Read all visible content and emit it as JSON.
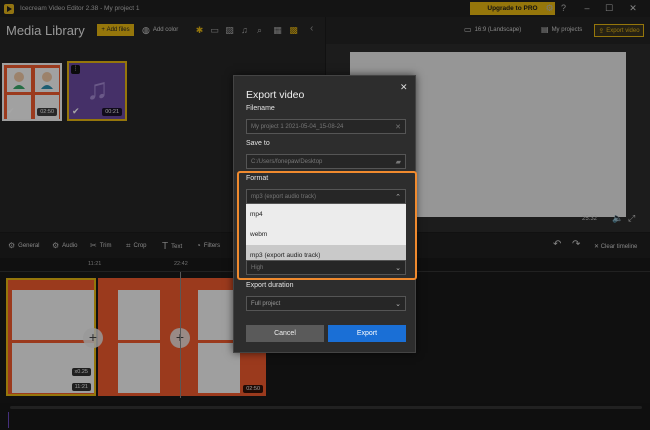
{
  "titlebar": {
    "title": "Icecream Video Editor 2.38 - My project 1",
    "upgrade_label": "Upgrade to PRO"
  },
  "media_library": {
    "title": "Media Library",
    "add_files": "Add files",
    "add_color": "Add color",
    "items": [
      {
        "duration": "02:50"
      },
      {
        "duration": "00:21"
      }
    ]
  },
  "preview": {
    "aspect_label": "16:9 (Landscape)",
    "my_projects": "My projects",
    "export_video": "Export video",
    "time": "25:32"
  },
  "tools": {
    "general": "General",
    "audio": "Audio",
    "trim": "Trim",
    "crop": "Crop",
    "text": "Text",
    "filters": "Filters",
    "clear_timeline": "Clear timeline"
  },
  "timeline": {
    "ruler": [
      "11:21",
      "22:42"
    ],
    "clip1": {
      "speed": "x0.25",
      "duration": "11:21"
    },
    "clip2": {
      "duration": "02:50"
    }
  },
  "dialog": {
    "title": "Export video",
    "filename_label": "Filename",
    "filename_value": "My project 1 2021-05-04_15-08-24",
    "save_to_label": "Save to",
    "save_to_value": "C:/Users/fonepaw/Desktop",
    "format_label": "Format",
    "format_value": "mp3 (export audio track)",
    "format_options": [
      "mp4",
      "webm",
      "mp3 (export audio track)"
    ],
    "quality_value": "High",
    "export_duration_label": "Export duration",
    "export_duration_value": "Full project",
    "cancel": "Cancel",
    "export": "Export"
  },
  "colors": {
    "accent": "#e5b512",
    "highlight": "#f08a2e",
    "primary_button": "#1a6fd6"
  }
}
